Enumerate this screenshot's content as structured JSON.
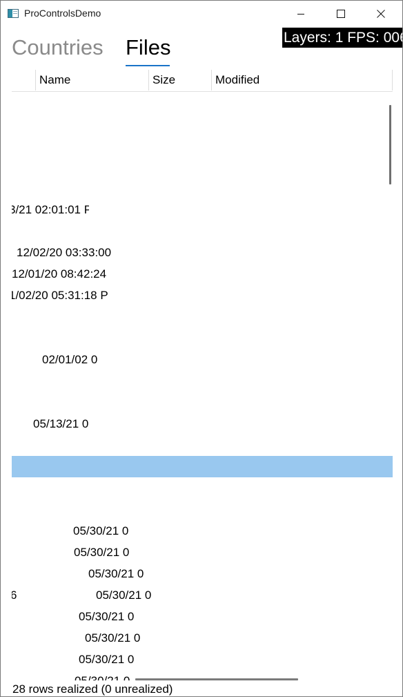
{
  "window": {
    "title": "ProControlsDemo",
    "fps_overlay": "Layers: 1 FPS: 006"
  },
  "tabs": [
    {
      "label": "Countries",
      "selected": false
    },
    {
      "label": "Files",
      "selected": true
    }
  ],
  "grid": {
    "columns": [
      "Name",
      "Size",
      "Modified"
    ],
    "fragments": [
      "3/21 02:01:01 P",
      "12/02/20 03:33:00",
      "12/01/20 08:42:24",
      "1/02/20 05:31:18 P",
      "02/01/02 0",
      "05/13/21 0",
      "05/30/21 0",
      "05/30/21 0",
      "05/30/21 0",
      "6",
      "05/30/21 0",
      "05/30/21 0",
      "05/30/21 0",
      "05/30/21 0",
      "05/30/21 0"
    ]
  },
  "status": "28 rows realized (0 unrealized)",
  "colors": {
    "accent": "#1a73c8",
    "selection": "#99c8ef",
    "inactive_tab": "#8a8a8a"
  }
}
